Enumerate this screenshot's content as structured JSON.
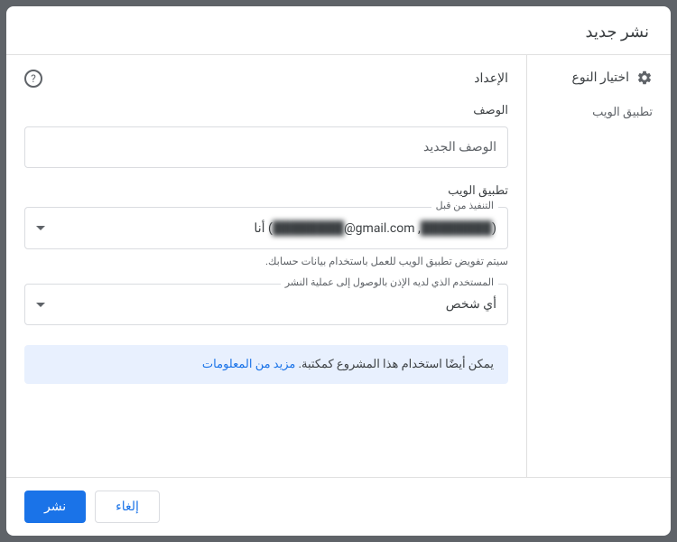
{
  "dialog": {
    "title": "نشر جديد"
  },
  "sidebar": {
    "header": "اختيار النوع",
    "items": [
      {
        "label": "تطبيق الويب"
      }
    ]
  },
  "main": {
    "title": "الإعداد"
  },
  "description": {
    "label": "الوصف",
    "placeholder": "الوصف الجديد"
  },
  "webapp": {
    "label": "تطبيق الويب",
    "execute_as": {
      "legend": "التنفيذ من قبل",
      "value_prefix": "أنا (",
      "value_email": "@gmail.com",
      "value_redacted": "████████",
      "value_suffix": ")",
      "helper": "سيتم تفويض تطبيق الويب للعمل باستخدام بيانات حسابك."
    },
    "access": {
      "legend": "المستخدم الذي لديه الإذن بالوصول إلى عملية النشر",
      "value": "أي شخص"
    }
  },
  "info": {
    "text": "يمكن أيضًا استخدام هذا المشروع كمكتبة. ",
    "link": "مزيد من المعلومات"
  },
  "footer": {
    "cancel": "إلغاء",
    "deploy": "نشر"
  }
}
